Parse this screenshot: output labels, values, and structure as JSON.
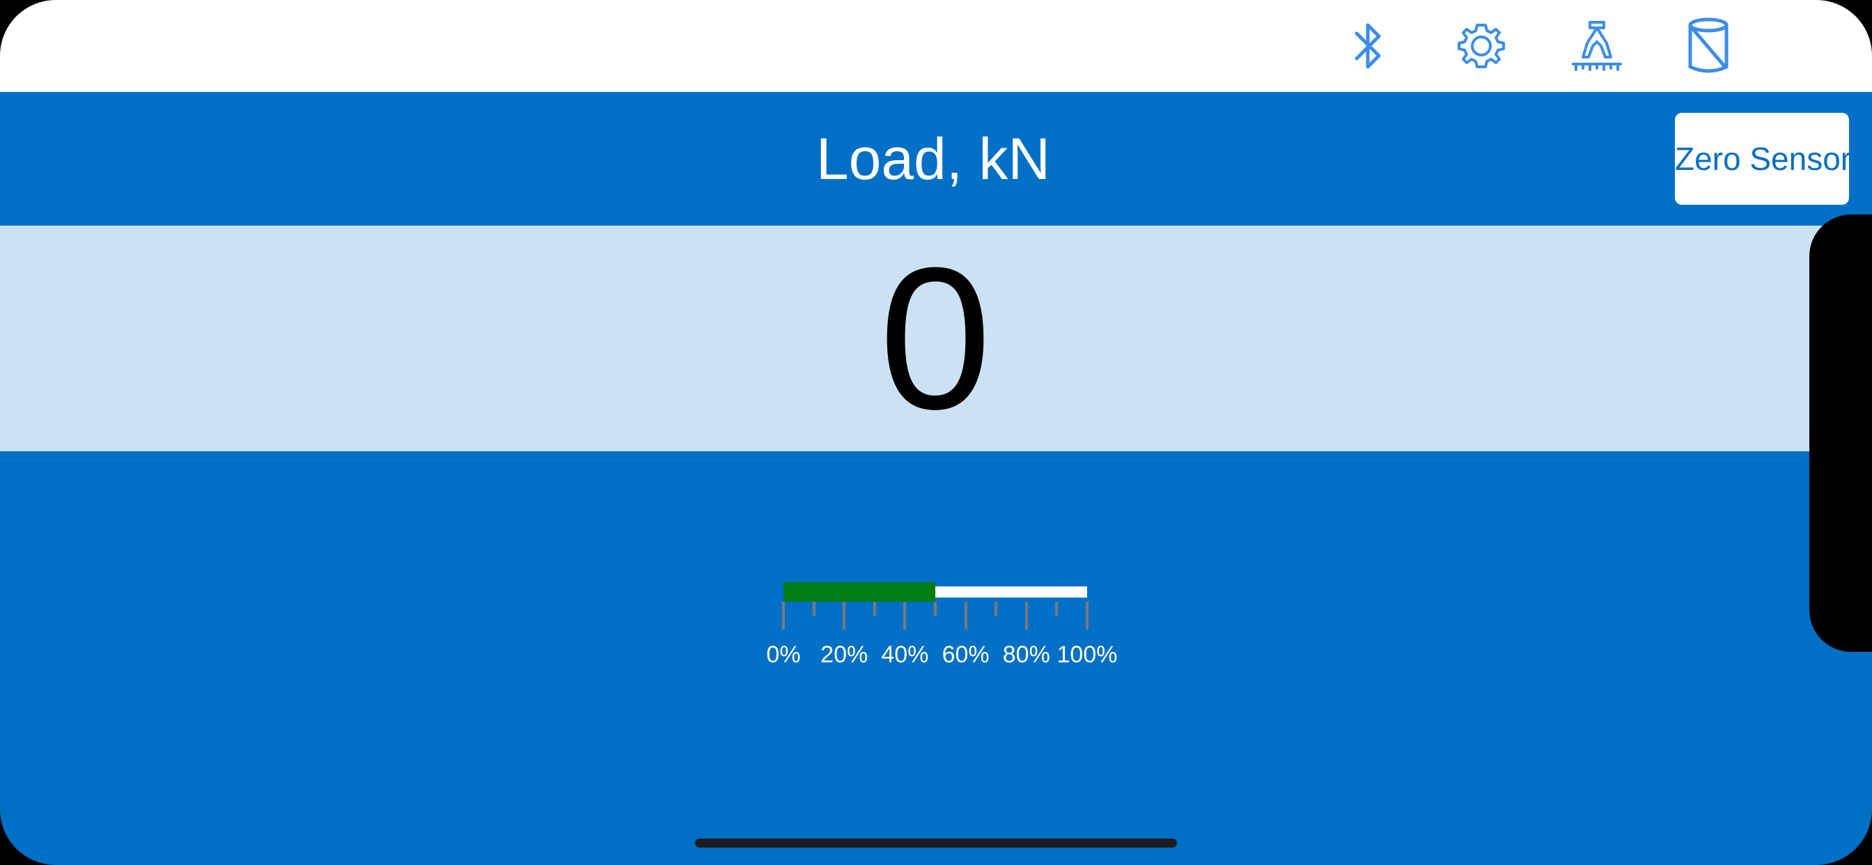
{
  "topbar": {
    "icons": [
      {
        "name": "bluetooth-icon",
        "label": "Bluetooth"
      },
      {
        "name": "gear-icon",
        "label": "Settings"
      },
      {
        "name": "clamp-ruler-icon",
        "label": "Calibration"
      },
      {
        "name": "cylinder-icon",
        "label": "Sensor"
      }
    ],
    "icon_color": "#3c8de6"
  },
  "header": {
    "title": "Load, kN",
    "zero_button_label": "Zero Sensor"
  },
  "reading": {
    "value": "0"
  },
  "gauge": {
    "fill_fraction": 0.5,
    "fill_color": "#007c15",
    "track_color": "#ffffff",
    "labels": [
      "0%",
      "20%",
      "40%",
      "60%",
      "80%",
      "100%"
    ]
  },
  "colors": {
    "primary": "#0070c6",
    "value_band": "#cce2f3"
  }
}
